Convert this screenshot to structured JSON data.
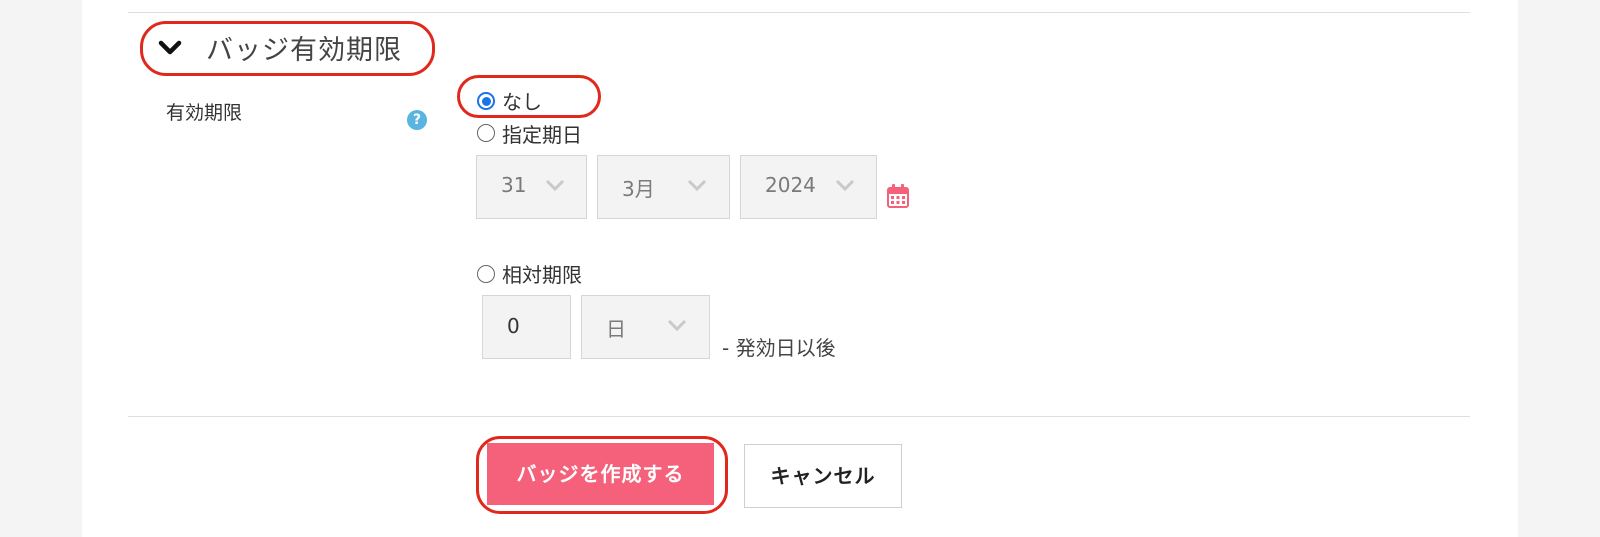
{
  "section": {
    "title": "バッジ有効期限"
  },
  "field": {
    "label": "有効期限",
    "help_icon": "question-circle-icon",
    "help_glyph": "?"
  },
  "options": [
    {
      "label": "なし",
      "selected": true
    },
    {
      "label": "指定期日",
      "selected": false
    },
    {
      "label": "相対期限",
      "selected": false
    }
  ],
  "fixed_date": {
    "day": "31",
    "month": "3月",
    "year": "2024",
    "calendar_icon": "calendar-icon"
  },
  "relative": {
    "amount": "0",
    "unit": "日",
    "suffix": "- 発効日以後"
  },
  "buttons": {
    "create": "バッジを作成する",
    "cancel": "キャンセル"
  },
  "colors": {
    "accent": "#f5607a",
    "highlight": "#e0281c",
    "radio": "#1a73e8",
    "help": "#5ab4e0"
  }
}
